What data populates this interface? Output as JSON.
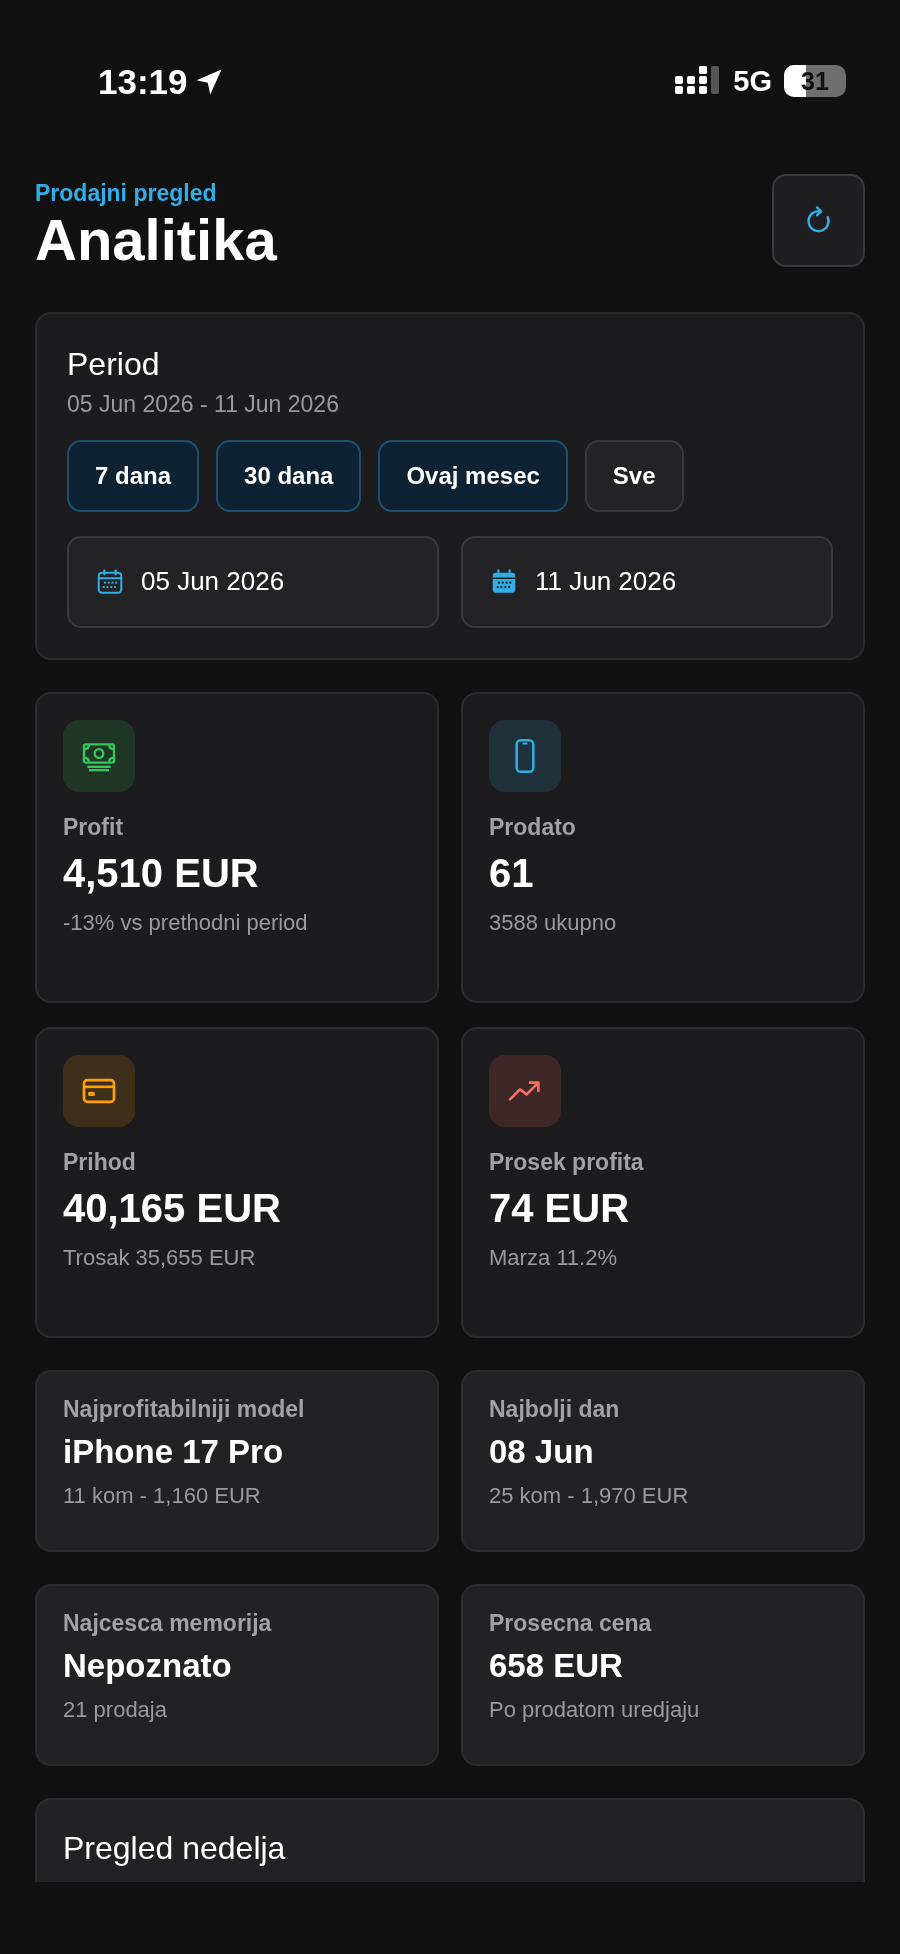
{
  "status_bar": {
    "time": "13:19",
    "network": "5G",
    "battery": "31"
  },
  "header": {
    "eyebrow": "Prodajni pregled",
    "title": "Analitika"
  },
  "period": {
    "title": "Period",
    "range": "05 Jun 2026 - 11 Jun 2026",
    "presets": [
      {
        "label": "7 dana",
        "selected": true
      },
      {
        "label": "30 dana",
        "selected": true
      },
      {
        "label": "Ovaj mesec",
        "selected": true
      },
      {
        "label": "Sve",
        "selected": false
      }
    ],
    "dates": [
      {
        "kind": "outline",
        "value": "05 Jun 2026"
      },
      {
        "kind": "filled",
        "value": "11 Jun 2026"
      }
    ]
  },
  "stats": [
    {
      "kind": "money",
      "color": "#34c759",
      "label": "Profit",
      "value": "4,510 EUR",
      "note": "-13% vs prethodni period"
    },
    {
      "kind": "phone",
      "color": "#32ade6",
      "label": "Prodato",
      "value": "61",
      "note": "3588 ukupno"
    },
    {
      "kind": "card",
      "color": "#ff9f0a",
      "label": "Prihod",
      "value": "40,165 EUR",
      "note": "Trosak 35,655 EUR"
    },
    {
      "kind": "trend",
      "color": "#ff6961",
      "label": "Prosek profita",
      "value": "74 EUR",
      "note": "Marza 11.2%"
    }
  ],
  "highlights": [
    {
      "label": "Najprofitabilniji model",
      "value": "iPhone 17 Pro",
      "note": "11 kom - 1,160 EUR"
    },
    {
      "label": "Najbolji dan",
      "value": "08 Jun",
      "note": "25 kom - 1,970 EUR"
    },
    {
      "label": "Najcesca memorija",
      "value": "Nepoznato",
      "note": "21 prodaja"
    },
    {
      "label": "Prosecna cena",
      "value": "658 EUR",
      "note": "Po prodatom uredjaju"
    }
  ],
  "weekly": {
    "title": "Pregled nedelja"
  }
}
